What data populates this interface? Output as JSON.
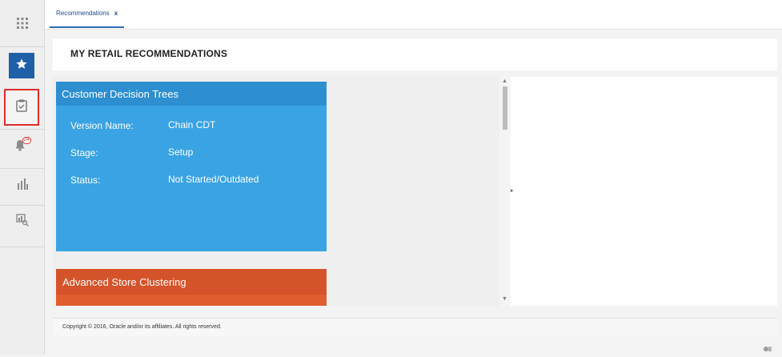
{
  "sidebar": {
    "items": [
      {
        "name": "apps-grid",
        "icon": "apps-grid-icon"
      },
      {
        "name": "favorites",
        "icon": "star-icon",
        "active": true
      },
      {
        "name": "tasks",
        "icon": "clipboard-icon",
        "highlighted": true
      },
      {
        "name": "notifications",
        "icon": "bell-icon",
        "badge": "24"
      },
      {
        "name": "reports",
        "icon": "bar-chart-icon"
      },
      {
        "name": "search-report",
        "icon": "report-search-icon"
      }
    ]
  },
  "tabs": [
    {
      "label": "Recommendations",
      "close": "x"
    }
  ],
  "header": {
    "title": "MY RETAIL RECOMMENDATIONS"
  },
  "cards": [
    {
      "title": "Customer Decision Trees",
      "color": "#3aa3e3",
      "fields": [
        {
          "label": "Version Name:",
          "value": "Chain CDT"
        },
        {
          "label": "Stage:",
          "value": "Setup"
        },
        {
          "label": "Status:",
          "value": "Not Started/Outdated"
        }
      ]
    },
    {
      "title": "Advanced Store Clustering",
      "color": "#e05d2e"
    }
  ],
  "footer": {
    "copyright": "Copyright © 2016, Oracle and/or its affiliates. All rights reserved."
  },
  "colors": {
    "accent": "#1f5fa8",
    "highlight_border": "#e02b2b"
  }
}
